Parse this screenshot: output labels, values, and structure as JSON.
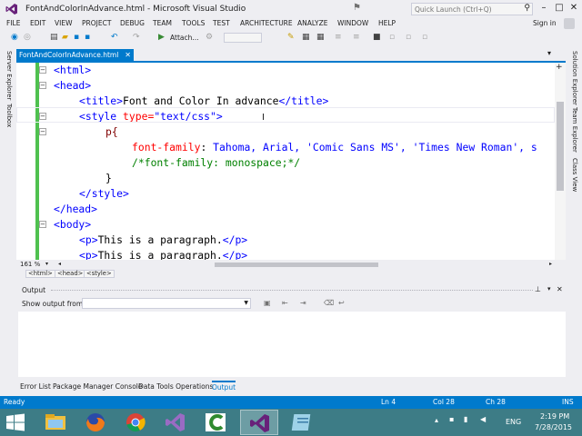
{
  "window": {
    "title": "FontAndColorInAdvance.html - Microsoft Visual Studio",
    "quick_launch_placeholder": "Quick Launch (Ctrl+Q)",
    "min": "–",
    "max": "□",
    "close": "✕"
  },
  "menu": [
    "FILE",
    "EDIT",
    "VIEW",
    "PROJECT",
    "DEBUG",
    "TEAM",
    "TOOLS",
    "TEST",
    "ARCHITECTURE",
    "ANALYZE",
    "WINDOW",
    "HELP"
  ],
  "account": {
    "signin": "Sign in"
  },
  "toolbar": {
    "attach": "Attach..."
  },
  "side_tabs": {
    "left": [
      "Server Explorer",
      "Toolbox"
    ],
    "right": [
      "Solution Explorer",
      "Team Explorer",
      "Class View"
    ]
  },
  "document": {
    "tab": "FontAndColorInAdvance.html",
    "code_lines": [
      [
        "<html>"
      ],
      [
        "<head>"
      ],
      [
        "<title>",
        "Font and Color In advance",
        "</title>"
      ],
      [
        "<style",
        " type=",
        "\"text/css\"",
        ">"
      ],
      [
        "p{"
      ],
      [
        "font-family",
        ": ",
        "Tahoma, Arial, 'Comic Sans MS', 'Times New Roman', s"
      ],
      [
        "/*font-family: monospace;*/"
      ],
      [
        "}"
      ],
      [
        "</style>"
      ],
      [
        "</head>"
      ],
      [
        "<body>"
      ],
      [
        "<p>",
        "This is a paragraph.",
        "</p>"
      ],
      [
        "<p>",
        "This is a paragraph.",
        "</p>"
      ]
    ],
    "zoom": "161 %",
    "breadcrumb": [
      "<html>",
      "<head>",
      "<style>"
    ]
  },
  "output_panel": {
    "title": "Output",
    "show_from": "Show output from:",
    "selected": ""
  },
  "bottom_tabs": [
    "Error List",
    "Package Manager Console",
    "Data Tools Operations",
    "Output"
  ],
  "status": {
    "ready": "Ready",
    "ln": "Ln 4",
    "col": "Col 28",
    "ch": "Ch 28",
    "ins": "INS"
  },
  "tray": {
    "lang": "ENG",
    "time": "2:19 PM",
    "date": "7/28/2015"
  },
  "colors": {
    "accent": "#007acc",
    "taskbar": "#3d7c86",
    "vs_purple": "#68217a"
  }
}
